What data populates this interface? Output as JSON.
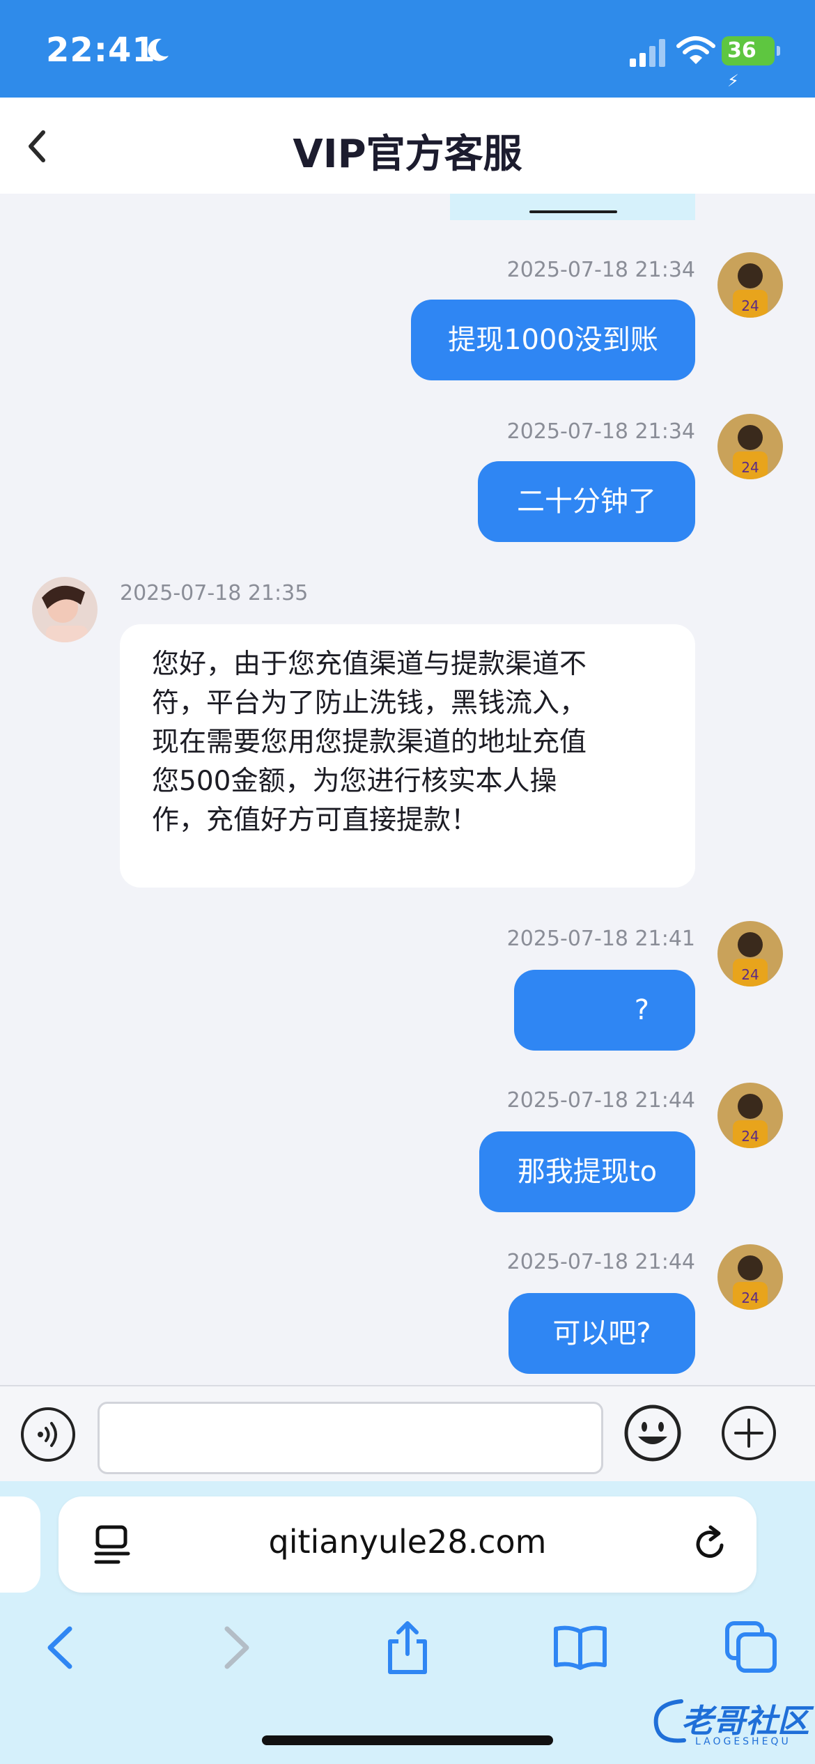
{
  "status_bar": {
    "time": "22:41",
    "battery": "36"
  },
  "nav": {
    "title": "VIP官方客服"
  },
  "messages": [
    {
      "side": "out",
      "time": "2025-07-18 21:34",
      "text": "提现1000没到账"
    },
    {
      "side": "out",
      "time": "2025-07-18 21:34",
      "text": "二十分钟了"
    },
    {
      "side": "in",
      "time": "2025-07-18 21:35",
      "lines": [
        "您好，由于您充值渠道与提款渠道不",
        "符，平台为了防止洗钱，黑钱流入，",
        "现在需要您用您提款渠道的地址充值",
        "您500金额，为您进行核实本人操",
        "作，充值好方可直接提款！"
      ]
    },
    {
      "side": "out",
      "time": "2025-07-18 21:41",
      "text": "?"
    },
    {
      "side": "out",
      "time": "2025-07-18 21:44",
      "text": "那我提现to"
    },
    {
      "side": "out",
      "time": "2025-07-18 21:44",
      "text": "可以吧?"
    }
  ],
  "input": {
    "value": ""
  },
  "browser": {
    "url": "qitianyule28.com"
  },
  "watermark": {
    "text": "老哥社区",
    "sub": "LAOGESHEQU"
  },
  "icons": {
    "moon": "moon-icon",
    "signal": "signal-icon",
    "wifi": "wifi-icon",
    "back": "chevron-left-icon",
    "voice": "voice-icon",
    "emoji": "smiley-icon",
    "plus": "plus-icon",
    "reload": "reload-icon",
    "share": "share-icon",
    "bookmarks": "book-icon",
    "tabs": "tabs-icon"
  },
  "colors": {
    "accent": "#2f86f3",
    "status_bar": "#2f8bea",
    "browser_bar": "#d5f0fb"
  }
}
